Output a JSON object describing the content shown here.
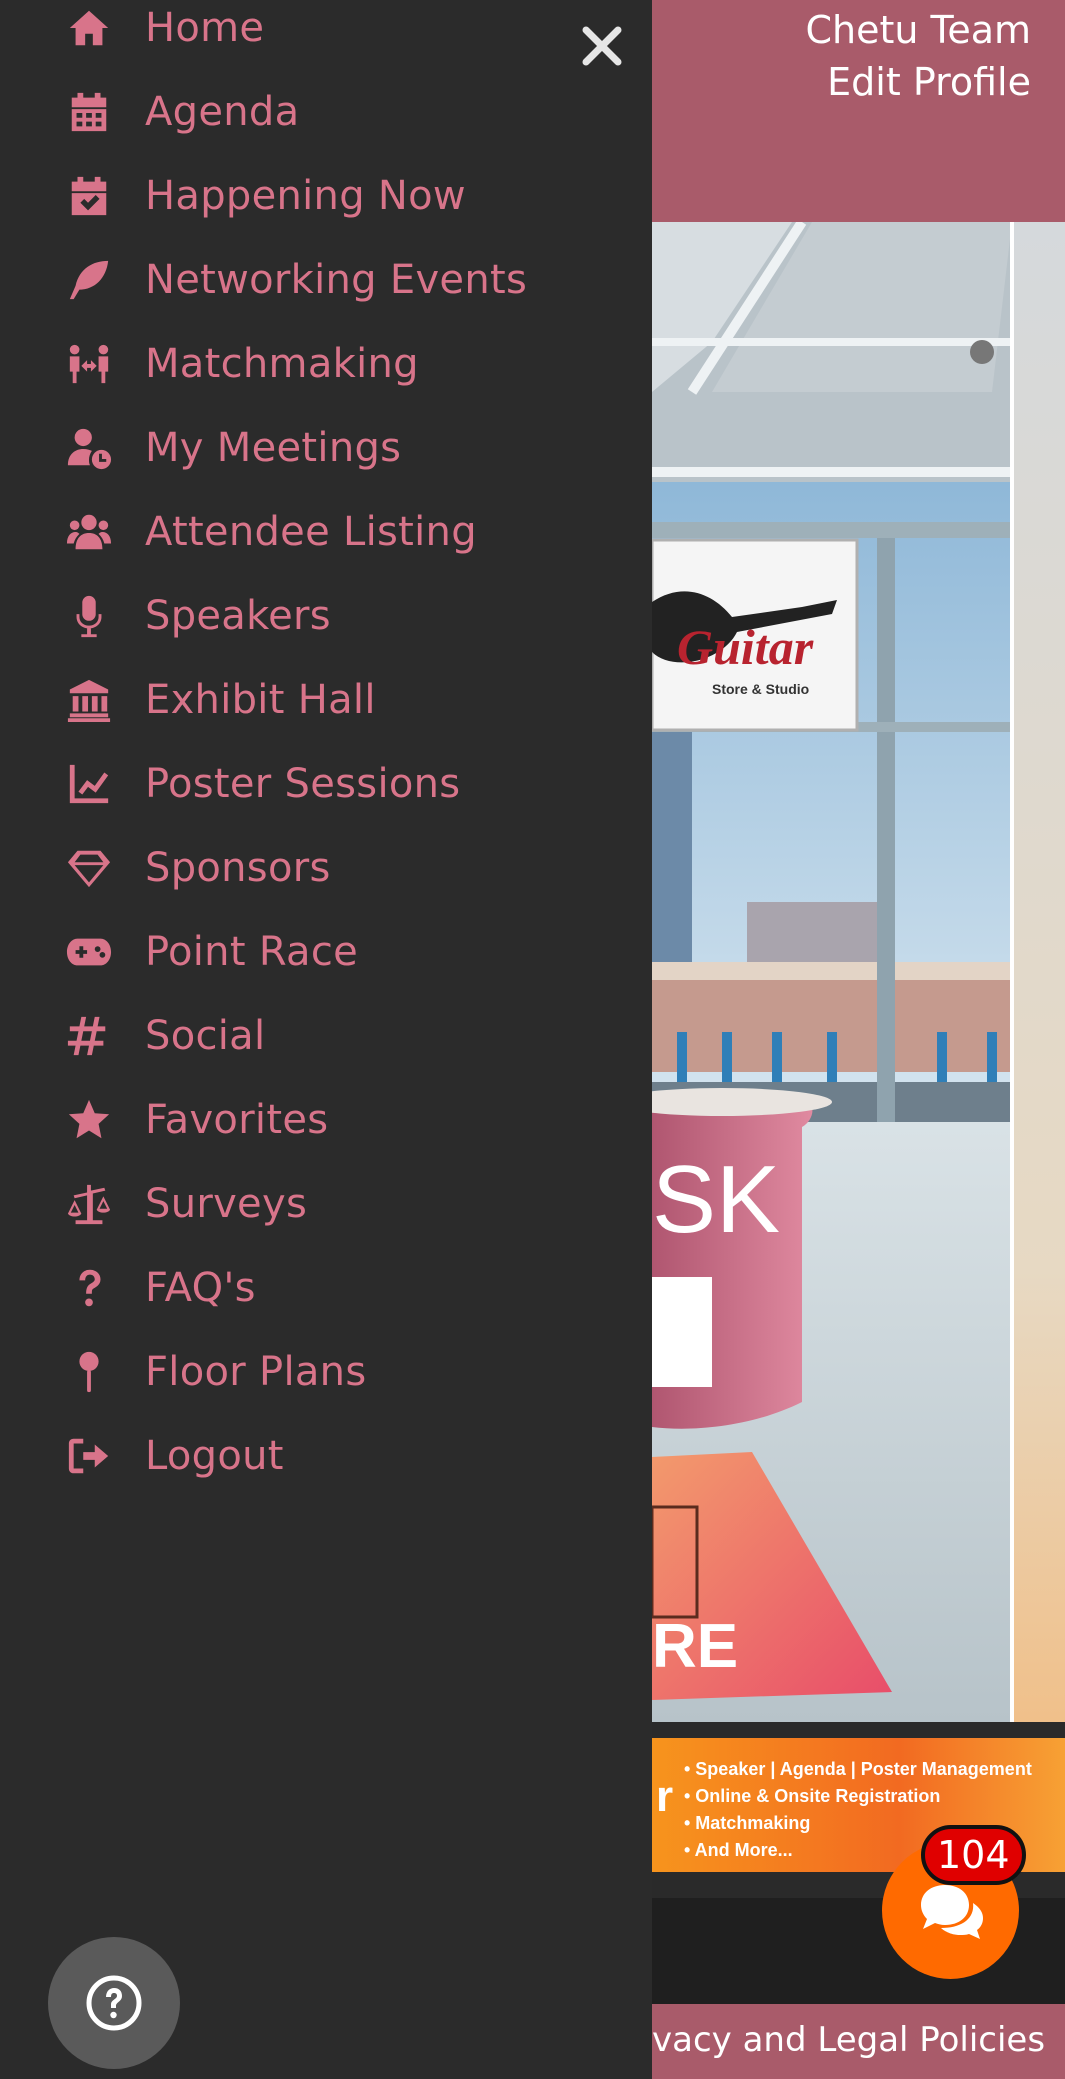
{
  "header": {
    "team_name": "Chetu Team",
    "edit_profile": "Edit Profile"
  },
  "drawer": {
    "close_icon": "close-icon",
    "items": [
      {
        "label": "Home",
        "icon": "home-icon"
      },
      {
        "label": "Agenda",
        "icon": "calendar-icon"
      },
      {
        "label": "Happening Now",
        "icon": "calendar-check-icon"
      },
      {
        "label": "Networking Events",
        "icon": "feather-icon"
      },
      {
        "label": "Matchmaking",
        "icon": "people-arrows-icon"
      },
      {
        "label": "My Meetings",
        "icon": "user-clock-icon"
      },
      {
        "label": "Attendee Listing",
        "icon": "users-icon"
      },
      {
        "label": "Speakers",
        "icon": "microphone-icon"
      },
      {
        "label": "Exhibit Hall",
        "icon": "landmark-icon"
      },
      {
        "label": "Poster Sessions",
        "icon": "chart-line-icon"
      },
      {
        "label": "Sponsors",
        "icon": "gem-icon"
      },
      {
        "label": "Point Race",
        "icon": "gamepad-icon"
      },
      {
        "label": "Social",
        "icon": "hashtag-icon"
      },
      {
        "label": "Favorites",
        "icon": "star-icon"
      },
      {
        "label": "Surveys",
        "icon": "balance-scale-icon"
      },
      {
        "label": "FAQ's",
        "icon": "question-icon"
      },
      {
        "label": "Floor Plans",
        "icon": "map-pin-icon"
      },
      {
        "label": "Logout",
        "icon": "sign-out-icon"
      }
    ]
  },
  "lobby": {
    "sign_brand": "Guitar",
    "sign_tagline": "Store & Studio",
    "desk_text": "SK",
    "floor_text": "RE"
  },
  "promo": {
    "mark": "r",
    "lines": [
      "• Speaker | Agenda | Poster Management",
      "• Online & Onsite Registration",
      "• Matchmaking",
      "• And More..."
    ]
  },
  "footer": {
    "text": "vacy and Legal Policies"
  },
  "chat": {
    "badge_count": "104",
    "icon": "comments-icon"
  },
  "help": {
    "icon": "question-circle-icon"
  },
  "colors": {
    "accent_pink": "#d8748a",
    "header_bg": "#a95b6a",
    "drawer_bg": "#2b2b2b",
    "chat_orange": "#ff6a00",
    "badge_red": "#e00000"
  }
}
